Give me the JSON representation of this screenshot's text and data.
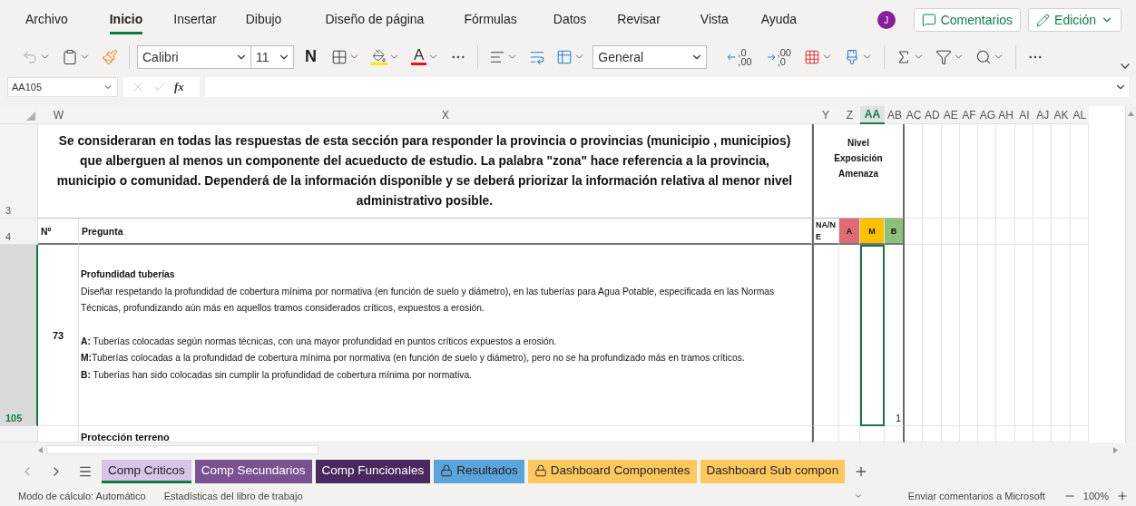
{
  "ribbon_tabs": [
    {
      "label": "Archivo",
      "selected": false
    },
    {
      "label": "Inicio",
      "selected": true
    },
    {
      "label": "Insertar",
      "selected": false
    },
    {
      "label": "Dibujo",
      "selected": false
    },
    {
      "label": "Diseño de página",
      "selected": false
    },
    {
      "label": "Fórmulas",
      "selected": false
    },
    {
      "label": "Datos",
      "selected": false
    },
    {
      "label": "Revisar",
      "selected": false
    },
    {
      "label": "Vista",
      "selected": false
    },
    {
      "label": "Ayuda",
      "selected": false
    }
  ],
  "user": {
    "initial": "J"
  },
  "comments_button": "Comentarios",
  "editing_button": "Edición",
  "toolbar": {
    "font": "Calibri",
    "font_size": "11",
    "bold": "N",
    "font_color_letter": "A",
    "number_format": "General",
    "decimal_buttons": [
      {
        "top": ",0",
        "bottom": ",00"
      },
      {
        "top": ",00",
        "bottom": ",0"
      }
    ]
  },
  "formula_bar": {
    "name_box": "AA105",
    "function_label": "fx"
  },
  "columns": [
    {
      "label": "W",
      "selected": false
    },
    {
      "label": "X",
      "selected": false
    },
    {
      "label": "Y",
      "selected": false
    },
    {
      "label": "Z",
      "selected": false
    },
    {
      "label": "AA",
      "selected": true
    },
    {
      "label": "AB",
      "selected": false
    },
    {
      "label": "AC",
      "selected": false
    },
    {
      "label": "AD",
      "selected": false
    },
    {
      "label": "AE",
      "selected": false
    },
    {
      "label": "AF",
      "selected": false
    },
    {
      "label": "AG",
      "selected": false
    },
    {
      "label": "AH",
      "selected": false
    },
    {
      "label": "AI",
      "selected": false
    },
    {
      "label": "AJ",
      "selected": false
    },
    {
      "label": "AK",
      "selected": false
    },
    {
      "label": "AL",
      "selected": false
    }
  ],
  "intro_row": {
    "row": "3",
    "text": "Se consideraran en todas las respuestas de esta sección para responder la provincia o provincias (municipio , municipios) que alberguen al menos un componente del acueducto de estudio. La palabra \"zona\" hace referencia a la provincia, municipio o comunidad. Dependerá de la información disponible y se deberá priorizar la información relativa al menor nivel administrativo posible.",
    "side_title": "Nivel Exposición Amenaza"
  },
  "label_row": {
    "row": "4",
    "number": "Nº",
    "question": "Pregunta",
    "levels": [
      {
        "label": "NA/NE",
        "color": "#ffffff"
      },
      {
        "label": "A",
        "color": "#e06b74"
      },
      {
        "label": "M",
        "color": "#ffc000"
      },
      {
        "label": "B",
        "color": "#8cc17a"
      }
    ]
  },
  "question_row": {
    "row": "105",
    "selected": true,
    "number": "73",
    "title": "Profundidad tuberías",
    "paragraphs": [
      "Diseñar respetando la profundidad de cobertura mínima por normativa (en función de suelo y diámetro), en las tuberías para Agua Potable, especificada en las Normas Técnicas, profundizando aún más en aquellos tramos considerados críticos, expuestos a erosión.",
      "**A:** Tuberías colocadas según normas técnicas, con una mayor profundidad en puntos críticos expuestos a erosión.",
      "**M:**Tuberías colocadas a la profundidad de cobertura mínima  por normativa (en función de suelo y diámetro), pero no se ha profundizado más en tramos críticos.",
      "**B:** Tuberías han sido colocadas sin  cumplir la profundidad de cobertura mínima por normativa."
    ],
    "value": "1"
  },
  "next_row": {
    "title": "Protección terreno"
  },
  "sheet_tabs": [
    {
      "label": "Comp Criticos",
      "color": "#d9c3e9",
      "locked": false,
      "selected": true
    },
    {
      "label": "Comp Secundarios",
      "color": "#7b5290",
      "locked": false,
      "selected": false
    },
    {
      "label": "Comp Funcionales",
      "color": "#4a2a5e",
      "locked": false,
      "selected": false
    },
    {
      "label": "Resultados",
      "color": "#5ba4da",
      "locked": true,
      "selected": false
    },
    {
      "label": "Dashboard Componentes",
      "color": "#ffc85f",
      "locked": true,
      "selected": false
    },
    {
      "label": "Dashboard Sub compon",
      "color": "#ffc85f",
      "locked": false,
      "selected": false
    }
  ],
  "status_bar": {
    "calc_mode": "Modo de cálculo: Automático",
    "stats": "Estadísticas del libro de trabajo",
    "feedback": "Enviar comentarios a Microsoft",
    "zoom": "100%"
  }
}
